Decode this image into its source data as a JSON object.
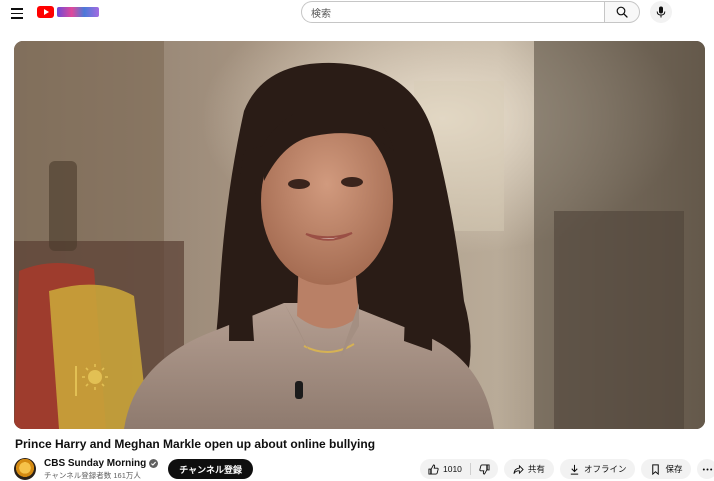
{
  "search": {
    "placeholder": "検索"
  },
  "video": {
    "title": "Prince Harry and Meghan Markle open up about online bullying"
  },
  "channel": {
    "name": "CBS Sunday Morning",
    "subscribers": "チャンネル登録者数 161万人",
    "subscribe_label": "チャンネル登録"
  },
  "actions": {
    "like_count": "1010",
    "share_label": "共有",
    "offline_label": "オフライン",
    "save_label": "保存"
  },
  "colors": {
    "brand_red": "#ff0000",
    "text_primary": "#0f0f0f",
    "text_secondary": "#606060",
    "pill_bg": "#f2f2f2"
  }
}
